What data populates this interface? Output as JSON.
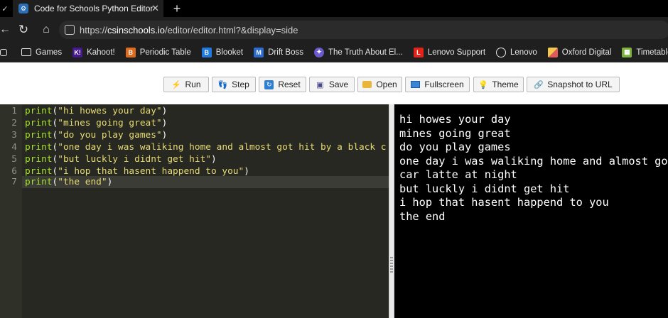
{
  "browser": {
    "tab_title": "Code for Schools Python Editor",
    "url_scheme": "https://",
    "url_host": "csinschools.io",
    "url_path": "/editor/editor.html?&display=side",
    "bookmarks": [
      {
        "label": "Games",
        "icon": "folder-icon",
        "color": "#e6e6e6"
      },
      {
        "label": "Kahoot!",
        "icon": "kahoot-icon",
        "color": "#46178f"
      },
      {
        "label": "Periodic Table",
        "icon": "periodic-table-icon",
        "color": "#e06a1b"
      },
      {
        "label": "Blooket",
        "icon": "blooket-icon",
        "color": "#1f7ae0"
      },
      {
        "label": "Drift Boss",
        "icon": "drift-boss-icon",
        "color": "#2a6bd1"
      },
      {
        "label": "The Truth About El...",
        "icon": "truth-icon",
        "color": "#6a5acd"
      },
      {
        "label": "Lenovo Support",
        "icon": "lenovo-icon",
        "color": "#e2231a"
      },
      {
        "label": "Lenovo",
        "icon": "globe-icon",
        "color": "#e6e6e6"
      },
      {
        "label": "Oxford Digital",
        "icon": "oxford-icon",
        "color": "#f2c94c"
      },
      {
        "label": "Timetable",
        "icon": "timetable-icon",
        "color": "#7bb33a"
      }
    ]
  },
  "toolbar": {
    "run": "Run",
    "step": "Step",
    "reset": "Reset",
    "save": "Save",
    "open": "Open",
    "fullscreen": "Fullscreen",
    "theme": "Theme",
    "snapshot": "Snapshot to URL"
  },
  "editor": {
    "lines": [
      {
        "num": "1",
        "text": "\"hi howes your day\""
      },
      {
        "num": "2",
        "text": "\"mines going great\""
      },
      {
        "num": "3",
        "text": "\"do you play games\""
      },
      {
        "num": "4",
        "text": "\"one day i was waliking home and almost got hit by a black c"
      },
      {
        "num": "5",
        "text": "\"but luckly i didnt get hit\""
      },
      {
        "num": "6",
        "text": "\"i hop that hasent happend to you\""
      },
      {
        "num": "7",
        "text": "\"the end\""
      }
    ],
    "keyword": "print",
    "open_paren": "(",
    "close_paren": ")"
  },
  "output": {
    "lines": [
      "hi howes your day",
      "mines going great",
      "do you play games",
      "one day i was waliking home and almost got",
      "car latte at night",
      "but luckly i didnt get hit",
      "i hop that hasent happend to you",
      "the end"
    ]
  },
  "colors": {
    "editor_bg": "#272822",
    "string": "#e6db74",
    "function": "#a6e22e",
    "output_bg": "#000000"
  }
}
